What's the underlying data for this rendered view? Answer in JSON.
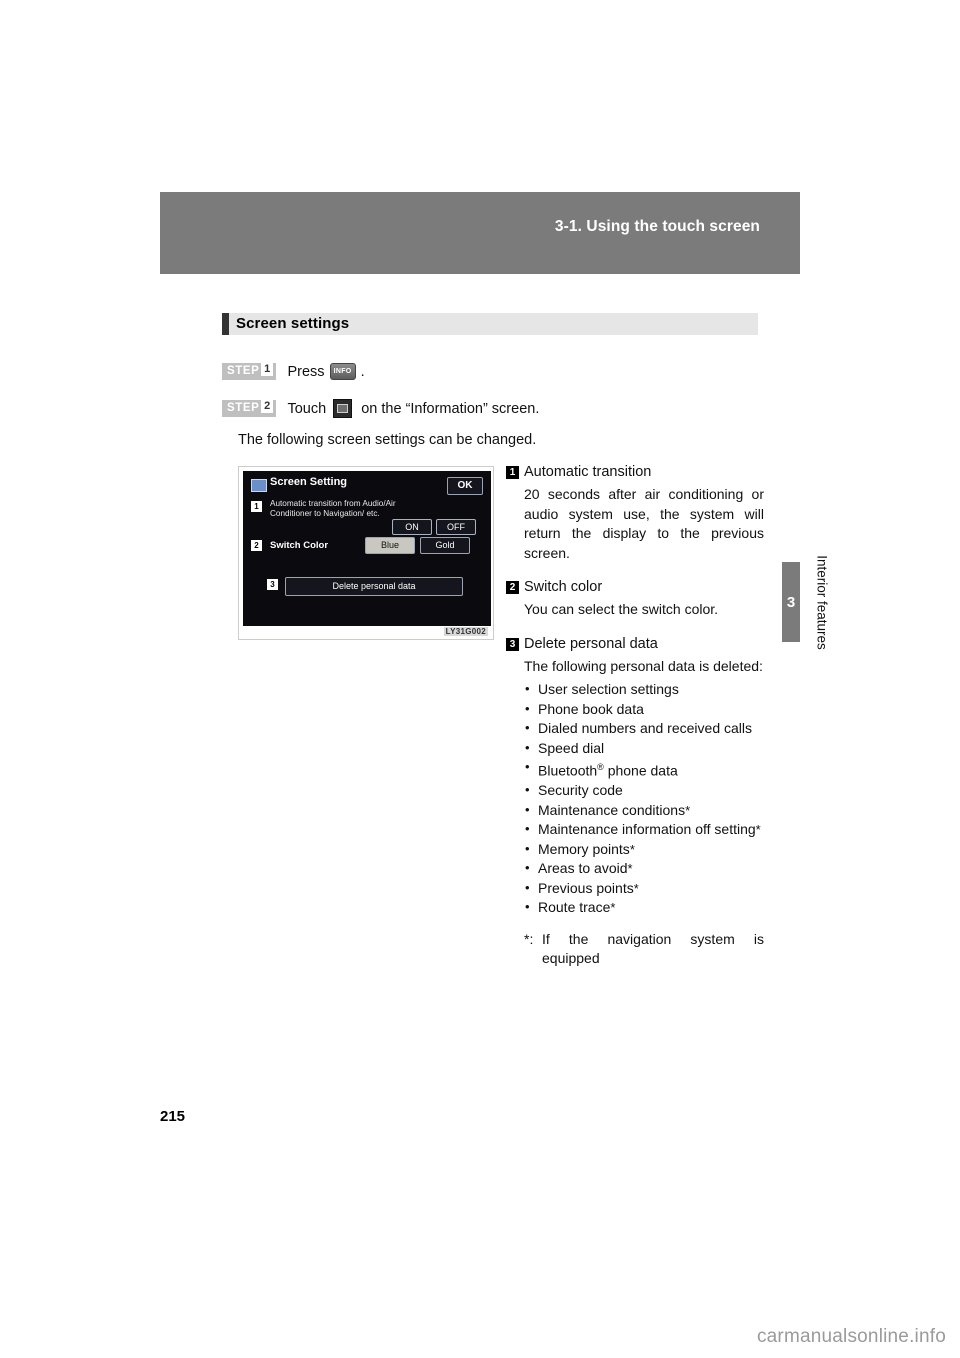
{
  "header": {
    "title": "3-1. Using the touch screen"
  },
  "side": {
    "chapter_number": "3",
    "chapter_label": "Interior features"
  },
  "section": {
    "title": "Screen settings"
  },
  "steps": [
    {
      "label": "STEP",
      "number": "1",
      "text_before": "Press",
      "icon": "info-button-icon",
      "icon_label": "INFO",
      "text_after": "."
    },
    {
      "label": "STEP",
      "number": "2",
      "text_before": "Touch",
      "icon": "screen-setting-button-icon",
      "text_after": "on the “Information” screen."
    }
  ],
  "intro_line": "The following screen settings can be changed.",
  "figure": {
    "title": "Screen Setting",
    "ok_label": "OK",
    "row1_number": "1",
    "row1_text": "Automatic transition from Audio/Air Conditioner to Navigation/ etc.",
    "on_label": "ON",
    "off_label": "OFF",
    "row2_number": "2",
    "row2_label": "Switch Color",
    "blue_label": "Blue",
    "gold_label": "Gold",
    "row3_number": "3",
    "delete_label": "Delete personal data",
    "figure_code": "LY31G002"
  },
  "items": [
    {
      "number": "1",
      "title": "Automatic transition",
      "body": "20 seconds after air conditioning or audio system use, the system will return the display to the previous screen."
    },
    {
      "number": "2",
      "title": "Switch color",
      "body": "You can select the switch color."
    },
    {
      "number": "3",
      "title": "Delete personal data",
      "body": "The following personal data is deleted:"
    }
  ],
  "bullets": [
    {
      "text": "User selection settings",
      "star": ""
    },
    {
      "text": "Phone book data",
      "star": ""
    },
    {
      "text": "Dialed numbers and received calls",
      "star": ""
    },
    {
      "text": "Speed dial",
      "star": ""
    },
    {
      "text": "Bluetooth",
      "sup": "®",
      "suffix": " phone data",
      "star": ""
    },
    {
      "text": "Security code",
      "star": ""
    },
    {
      "text": "Maintenance conditions",
      "star": "*"
    },
    {
      "text": "Maintenance information off setting",
      "star": "*"
    },
    {
      "text": "Memory points",
      "star": "*"
    },
    {
      "text": "Areas to avoid",
      "star": "*"
    },
    {
      "text": "Previous points",
      "star": "*"
    },
    {
      "text": "Route trace",
      "star": "*"
    }
  ],
  "footnote": {
    "mark": "*:",
    "text": "If the navigation system is equipped"
  },
  "page_number": "215",
  "watermark": {
    "text": "carmanualsonline.info"
  }
}
